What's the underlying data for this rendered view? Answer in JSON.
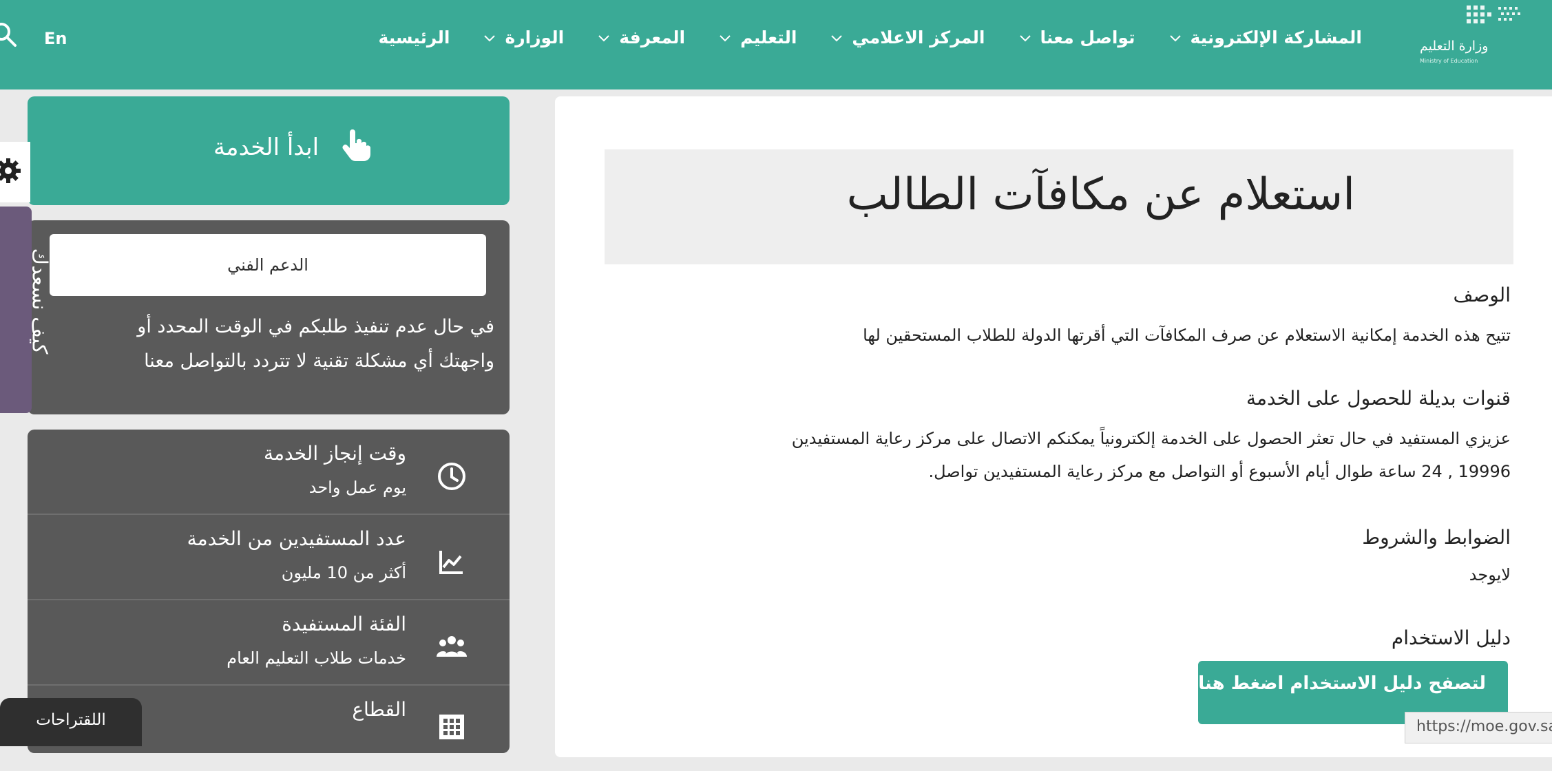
{
  "header": {
    "lang": "En",
    "logo_text": "وزارة التعليم",
    "logo_sub": "Ministry of Education",
    "nav": [
      {
        "label": "الرئيسية",
        "has_menu": false
      },
      {
        "label": "الوزارة",
        "has_menu": true
      },
      {
        "label": "المعرفة",
        "has_menu": true
      },
      {
        "label": "التعليم",
        "has_menu": true
      },
      {
        "label": "المركز الاعلامي",
        "has_menu": true
      },
      {
        "label": "تواصل معنا",
        "has_menu": true
      },
      {
        "label": "المشاركة الإلكترونية",
        "has_menu": true
      }
    ]
  },
  "main": {
    "title": "استعلام عن مكافآت الطالب",
    "description_heading": "الوصف",
    "description_text": "تتيح هذه الخدمة إمكانية الاستعلام عن صرف المكافآت التي أقرتها الدولة للطلاب المستحقين لها",
    "alt_channels_heading": "قنوات بديلة للحصول على الخدمة",
    "alt_channels_line1": "عزيزي المستفيد في حال تعثر الحصول على الخدمة إلكترونياً يمكنكم الاتصال على مركز رعاية المستفيدين",
    "alt_channels_line2": "19996 , 24 ساعة طوال أيام الأسبوع أو التواصل مع مركز رعاية المستفيدين تواصل.",
    "terms_heading": "الضوابط والشروط",
    "terms_text": "لايوجد",
    "guide_heading": "دليل الاستخدام",
    "guide_button": "لتصفح دليل الاستخدام اضغط هنا"
  },
  "sidebar": {
    "start_button": "ابدأ الخدمة",
    "support_button": "الدعم الفني",
    "support_text_line1": "في حال عدم تنفيذ طلبكم في الوقت المحدد أو",
    "support_text_line2": "واجهتك أي مشكلة تقنية لا تتردد بالتواصل معنا",
    "info": [
      {
        "title": "وقت إنجاز الخدمة",
        "value": "يوم عمل واحد",
        "icon": "clock-icon"
      },
      {
        "title": "عدد المستفيدين من الخدمة",
        "value": "أكثر من 10 مليون",
        "icon": "chart-icon"
      },
      {
        "title": "الفئة المستفيدة",
        "value": "خدمات طلاب التعليم العام",
        "icon": "users-icon"
      },
      {
        "title": "القطاع",
        "value": "",
        "icon": "grid-icon"
      }
    ]
  },
  "widgets": {
    "suggestions": "اللقتراحات",
    "vertical_tab": "كيف نسعدك",
    "status_url": "https://moe.gov.sa"
  },
  "colors": {
    "brand": "#3aaa96",
    "panel": "#5a5a5a",
    "accent_purple": "#6b5a7b"
  }
}
